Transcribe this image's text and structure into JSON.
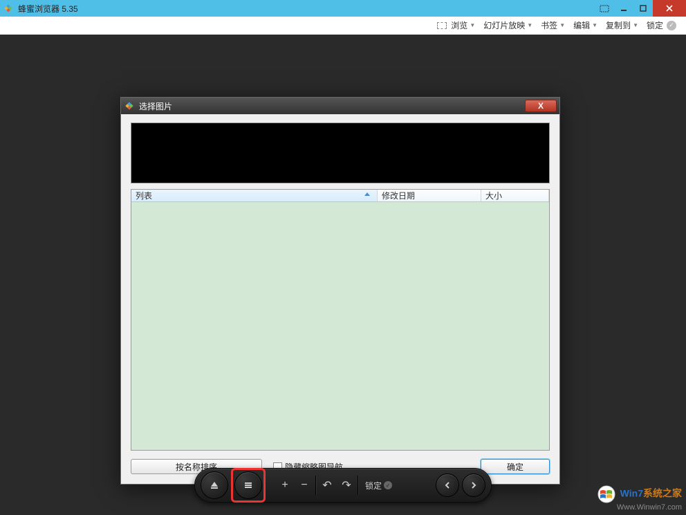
{
  "titlebar": {
    "title": "蜂蜜浏览器 5.35"
  },
  "menubar": {
    "browse": "浏览",
    "slideshow": "幻灯片放映",
    "bookmark": "书签",
    "edit": "编辑",
    "copyto": "复制到",
    "lock": "锁定"
  },
  "dialog": {
    "title": "选择图片",
    "columns": {
      "list": "列表",
      "mdate": "修改日期",
      "size": "大小"
    },
    "footer": {
      "sort_by_name": "按名称排序",
      "hide_thumb_nav": "隐藏缩略图导航",
      "ok": "确定"
    }
  },
  "bottombar": {
    "lock": "锁定"
  },
  "watermark": {
    "line1_a": "Win7",
    "line1_b": "系统之家",
    "line2": "Www.Winwin7.com"
  }
}
